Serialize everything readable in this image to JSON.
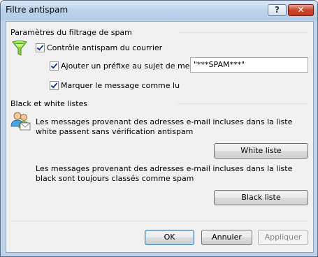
{
  "window": {
    "title": "Filtre antispam",
    "help_label": "?",
    "close_label": "✕"
  },
  "spam_group": {
    "title": "Paramètres du filtrage de spam",
    "antispam_check": {
      "label": "Contrôle antispam du courrier",
      "checked": true
    },
    "prefix_check": {
      "label": "Ajouter un préfixe au sujet de message",
      "checked": true,
      "value": "\"***SPAM***\""
    },
    "mark_read_check": {
      "label": "Marquer le message comme lu",
      "checked": true
    }
  },
  "lists_group": {
    "title": "Black et white listes",
    "white_desc": "Les messages provenant des adresses e-mail incluses dans la liste white passent sans vérification antispam",
    "white_button": "White liste",
    "black_desc": "Les messages provenant des adresses e-mail incluses dans la liste black sont toujours classés comme spam",
    "black_button": "Black liste"
  },
  "footer": {
    "ok": "OK",
    "cancel": "Annuler",
    "apply": "Appliquer"
  },
  "icons": {
    "filter": "funnel-icon",
    "users": "contacts-icon",
    "help": "question-icon",
    "close": "close-icon"
  },
  "colors": {
    "window_frame": "#bfd3ea",
    "close_button": "#c8462c",
    "check_mark": "#1f3c88"
  }
}
